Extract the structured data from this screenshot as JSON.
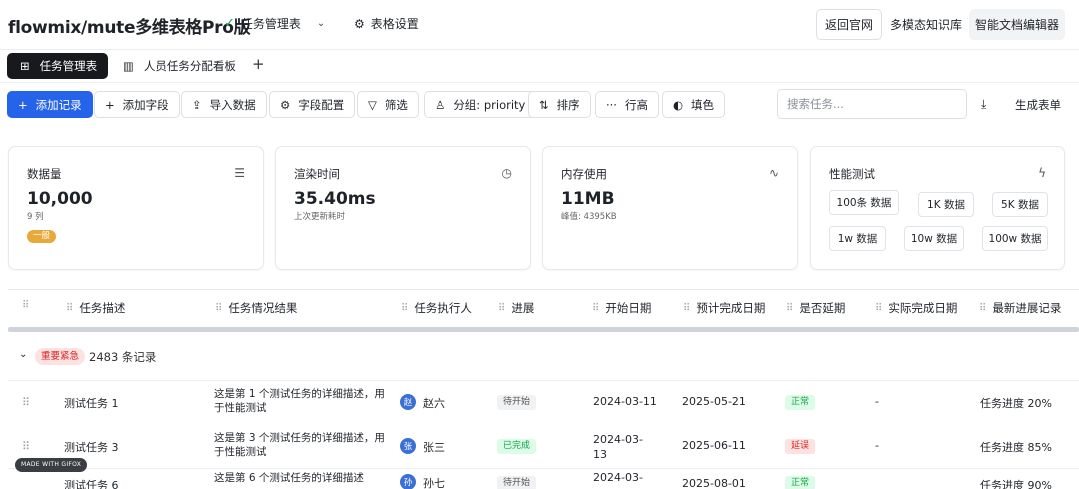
{
  "header": {
    "app_title": "flowmix/mute多维表格Pro版",
    "sheet_selector": "任务管理表",
    "table_settings": "表格设置",
    "buttons": {
      "back": "返回官网",
      "kb": "多模态知识库",
      "editor": "智能文档编辑器"
    }
  },
  "tabs": {
    "active": "任务管理表",
    "people": "人员任务分配看板",
    "add": "+"
  },
  "toolbar": {
    "add_record": "添加记录",
    "add_field": "添加字段",
    "import": "导入数据",
    "field_config": "字段配置",
    "filter": "筛选",
    "group": "分组: priority",
    "sort": "排序",
    "row_height": "行高",
    "fill": "填色",
    "search_placeholder": "搜索任务...",
    "generate_form": "生成表单"
  },
  "cards": {
    "count": {
      "title": "数据量",
      "value": "10,000",
      "sub": "9 列",
      "badge": "一般"
    },
    "render": {
      "title": "渲染时间",
      "value": "35.40ms",
      "sub": "上次更新耗时"
    },
    "memory": {
      "title": "内存使用",
      "value": "11MB",
      "sub": "峰值: 4395KB"
    },
    "perf": {
      "title": "性能测试",
      "buttons": [
        "100条 数据",
        "1K 数据",
        "5K 数据",
        "1w 数据",
        "10w 数据",
        "100w 数据"
      ]
    }
  },
  "table": {
    "columns": [
      "任务描述",
      "任务情况结果",
      "任务执行人",
      "进展",
      "开始日期",
      "预计完成日期",
      "是否延期",
      "实际完成日期",
      "最新进展记录"
    ],
    "group": {
      "tag": "重要紧急",
      "count": "2483 条记录"
    },
    "rows": [
      {
        "name": "测试任务 1",
        "desc": "这是第 1 个测试任务的详细描述，用于性能测试",
        "avatar": "赵",
        "assignee": "赵六",
        "status": "待开始",
        "start": "2024-03-11",
        "due": "2025-05-21",
        "delay": "正常",
        "actual": "-",
        "progress": "任务进度 20%"
      },
      {
        "name": "测试任务 3",
        "desc": "这是第 3 个测试任务的详细描述，用于性能测试",
        "avatar": "张",
        "assignee": "张三",
        "status": "已完成",
        "start": "2024-03-13",
        "due": "2025-06-11",
        "delay": "延误",
        "actual": "-",
        "progress": "任务进度 85%"
      },
      {
        "name": "测试任务 6",
        "desc": "这是第 6 个测试任务的详细描述",
        "avatar": "孙",
        "assignee": "孙七",
        "status": "待开始",
        "start": "2024-03-",
        "due": "2025-08-01",
        "delay": "正常",
        "actual": "",
        "progress": "任务进度 90%"
      }
    ]
  },
  "watermark": "MADE WITH GIFOX",
  "colors": {
    "primary": "#2563eb",
    "badge": "#e6a93a",
    "danger": "#dc2626",
    "success": "#16a34a"
  }
}
